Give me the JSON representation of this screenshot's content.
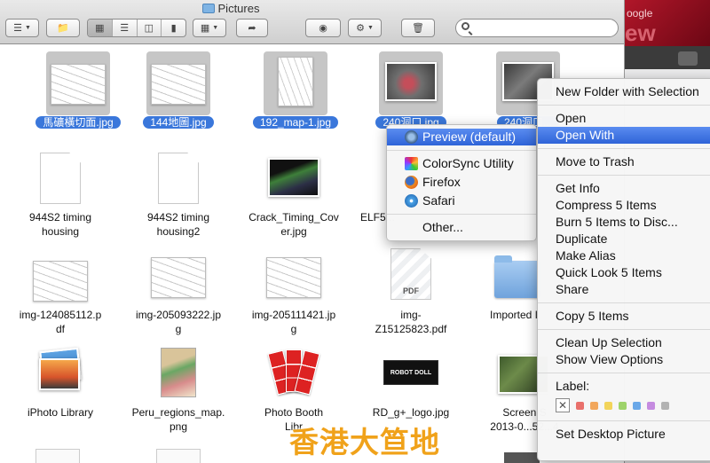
{
  "window": {
    "title": "Pictures"
  },
  "search": {
    "placeholder": "",
    "value": ""
  },
  "background_window": {
    "text_top": "oogle",
    "text_big": "ew"
  },
  "files": [
    {
      "name": "馬礦橫切面.jpg",
      "selected": true
    },
    {
      "name": "144地圖.jpg",
      "selected": true
    },
    {
      "name": "192_map-1.jpg",
      "selected": true
    },
    {
      "name": "240洞口.jpg",
      "selected": true
    },
    {
      "name": "240洞口...",
      "selected": true
    },
    {
      "name": "944S2 timing\nhousing",
      "selected": false
    },
    {
      "name": "944S2 timing\nhousing2",
      "selected": false
    },
    {
      "name": "Crack_Timing_Cov\ner.jpg",
      "selected": false
    },
    {
      "name": "ELF5...",
      "selected": false
    },
    {
      "name": "img-124085112.p\ndf",
      "selected": false
    },
    {
      "name": "img-205093222.jp\ng",
      "selected": false
    },
    {
      "name": "img-205111421.jp\ng",
      "selected": false
    },
    {
      "name": "img-\nZ15125823.pdf",
      "selected": false
    },
    {
      "name": "Imported I",
      "selected": false
    },
    {
      "name": "iPhoto Library",
      "selected": false
    },
    {
      "name": "Peru_regions_map.\npng",
      "selected": false
    },
    {
      "name": "Photo Booth\nLibr",
      "selected": false
    },
    {
      "name": "RD_g+_logo.jpg",
      "selected": false
    },
    {
      "name": "Screen S\n2013-0...52...4",
      "selected": false
    }
  ],
  "robot_label": "ROBOT DOLL",
  "open_with_submenu": {
    "items": [
      {
        "label": "Preview (default)",
        "icon": "preview-icon",
        "highlighted": true
      },
      {
        "label": "ColorSync Utility",
        "icon": "colorsync-icon"
      },
      {
        "label": "Firefox",
        "icon": "firefox-icon"
      },
      {
        "label": "Safari",
        "icon": "safari-icon"
      }
    ],
    "other": "Other..."
  },
  "context_menu": {
    "new_folder": "New Folder with Selection",
    "open": "Open",
    "open_with": "Open With",
    "move_to_trash": "Move to Trash",
    "get_info": "Get Info",
    "compress": "Compress 5 Items",
    "burn": "Burn 5 Items to Disc...",
    "duplicate": "Duplicate",
    "make_alias": "Make Alias",
    "quick_look": "Quick Look 5 Items",
    "share": "Share",
    "copy": "Copy 5 Items",
    "clean_up": "Clean Up Selection",
    "show_view_options": "Show View Options",
    "label": "Label:",
    "label_colors": [
      "#e9706b",
      "#f2a75c",
      "#f2d45a",
      "#9ed36a",
      "#6aa8e8",
      "#c58be0",
      "#b3b3b3"
    ],
    "set_desktop": "Set Desktop Picture"
  },
  "watermark": "香港大笪地"
}
